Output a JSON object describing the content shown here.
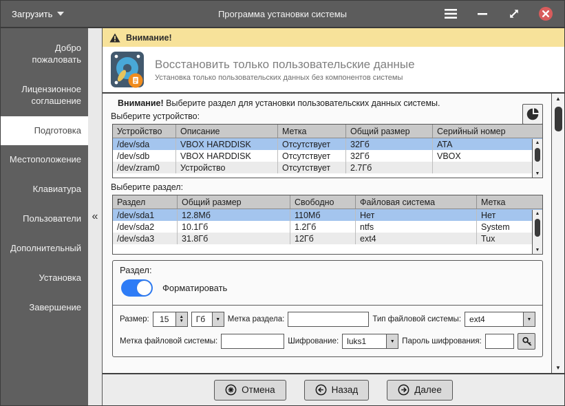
{
  "colors": {
    "titlebar_bg": "#5c5c5c",
    "sidebar_bg": "#5f5f5f",
    "warning_banner_bg": "#f7e29a",
    "selected_row": "#a4c5ee",
    "toggle_on": "#2e7cf6",
    "close_button": "#d85c5c"
  },
  "icons": {
    "up_arrow": "▲",
    "down_arrow": "▼"
  },
  "titlebar": {
    "menu_label": "Загрузить",
    "title": "Программа установки системы"
  },
  "sidebar": {
    "collapse_glyph": "«",
    "items": [
      {
        "label": "Добро пожаловать",
        "active": false
      },
      {
        "label": "Лицензионное соглашение",
        "active": false
      },
      {
        "label": "Подготовка",
        "active": true
      },
      {
        "label": "Местоположение",
        "active": false
      },
      {
        "label": "Клавиатура",
        "active": false
      },
      {
        "label": "Пользователи",
        "active": false
      },
      {
        "label": "Дополнительный",
        "active": false
      },
      {
        "label": "Установка",
        "active": false
      },
      {
        "label": "Завершение",
        "active": false
      }
    ]
  },
  "banner": {
    "label": "Внимание!"
  },
  "header": {
    "title": "Восстановить только пользовательские данные",
    "subtitle": "Установка только пользовательских данных без компонентов системы"
  },
  "content": {
    "notice": {
      "bold": "Внимание!",
      "text": "Выберите раздел для установки пользовательских данных системы."
    },
    "device_label": "Выберите устройство:",
    "device_table": {
      "headers": [
        "Устройство",
        "Описание",
        "Метка",
        "Общий размер",
        "Серийный номер"
      ],
      "selected_row": 0,
      "rows": [
        [
          "/dev/sda",
          "VBOX HARDDISK",
          "Отсутствует",
          "32Гб",
          "ATA"
        ],
        [
          "/dev/sdb",
          "VBOX HARDDISK",
          "Отсутствует",
          "32Гб",
          "VBOX"
        ],
        [
          "/dev/zram0",
          "Устройство",
          "Отсутствует",
          "2.7Гб",
          ""
        ]
      ]
    },
    "partition_label": "Выберите раздел:",
    "partition_table": {
      "headers": [
        "Раздел",
        "Общий размер",
        "Свободно",
        "Файловая система",
        "Метка"
      ],
      "selected_row": 0,
      "rows": [
        [
          "/dev/sda1",
          "12.8Мб",
          "110Мб",
          "Нет",
          "Нет"
        ],
        [
          "/dev/sda2",
          "10.1Гб",
          "1.2Гб",
          "ntfs",
          "System"
        ],
        [
          "/dev/sda3",
          "31.8Гб",
          "12Гб",
          "ext4",
          "Tux"
        ]
      ]
    },
    "form": {
      "group_label": "Раздел:",
      "format_label": "Форматировать",
      "format_on": true,
      "size_label": "Размер:",
      "size_value": "15",
      "unit_value": "Гб",
      "part_label_label": "Метка раздела:",
      "part_label_value": "",
      "fstype_label": "Тип файловой системы:",
      "fstype_value": "ext4",
      "fslabel_label": "Метка файловой системы:",
      "fslabel_value": "",
      "encryption_label": "Шифрование:",
      "encryption_value": "luks1",
      "password_label": "Пароль шифрования:",
      "password_value": ""
    }
  },
  "footer": {
    "cancel_label": "Отмена",
    "back_label": "Назад",
    "next_label": "Далее"
  }
}
